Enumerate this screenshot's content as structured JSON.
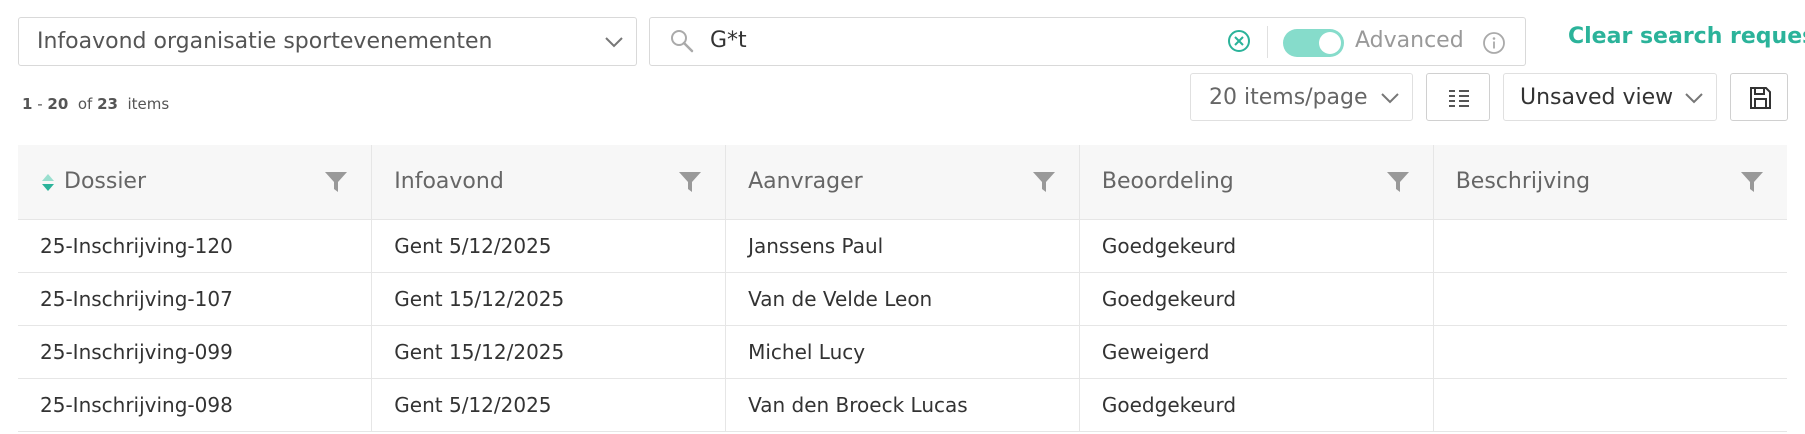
{
  "dropdown": {
    "value": "Infoavond organisatie sportevenementen"
  },
  "search": {
    "query": "G*t",
    "advanced_label": "Advanced",
    "advanced_enabled": true
  },
  "clear_search_label": "Clear search request",
  "pagination": {
    "range_start": "1",
    "range_end": "20",
    "of_label": "of",
    "total": "23",
    "items_label": "items"
  },
  "items_per_page": "20 items/page",
  "view": "Unsaved view",
  "accent_color": "#2bb39a",
  "table": {
    "columns": [
      {
        "label": "Dossier",
        "sorted": true
      },
      {
        "label": "Infoavond"
      },
      {
        "label": "Aanvrager"
      },
      {
        "label": "Beoordeling"
      },
      {
        "label": "Beschrijving"
      }
    ],
    "rows": [
      [
        "25-Inschrijving-120",
        "Gent 5/12/2025",
        "Janssens Paul",
        "Goedgekeurd",
        ""
      ],
      [
        "25-Inschrijving-107",
        "Gent 15/12/2025",
        "Van de Velde Leon",
        "Goedgekeurd",
        ""
      ],
      [
        "25-Inschrijving-099",
        "Gent 15/12/2025",
        "Michel Lucy",
        "Geweigerd",
        ""
      ],
      [
        "25-Inschrijving-098",
        "Gent 5/12/2025",
        "Van den Broeck Lucas",
        "Goedgekeurd",
        ""
      ]
    ]
  }
}
